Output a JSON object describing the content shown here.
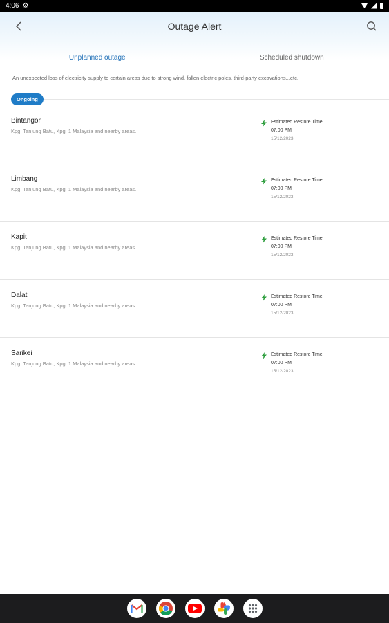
{
  "status_bar": {
    "time": "4:06"
  },
  "header": {
    "title": "Outage Alert"
  },
  "tabs": [
    {
      "label": "Unplanned outage",
      "active": true
    },
    {
      "label": "Scheduled shutdown",
      "active": false
    }
  ],
  "description": "An unexpected loss of electricity supply to certain areas due to strong wind, fallen electric poles, third-party excavations...etc.",
  "status_badge": "Ongoing",
  "outages": [
    {
      "name": "Bintangor",
      "areas": "Kpg. Tanjung Batu, Kpg. 1 Malaysia and nearby areas.",
      "restore_label": "Estimated Restore Time",
      "time": "07:00 PM",
      "date": "15/12/2023"
    },
    {
      "name": "Limbang",
      "areas": "Kpg. Tanjung Batu, Kpg. 1 Malaysia and nearby areas.",
      "restore_label": "Estimated Restore Time",
      "time": "07:00 PM",
      "date": "15/12/2023"
    },
    {
      "name": "Kapit",
      "areas": "Kpg. Tanjung Batu, Kpg. 1 Malaysia and nearby areas.",
      "restore_label": "Estimated Restore Time",
      "time": "07:00 PM",
      "date": "15/12/2023"
    },
    {
      "name": "Dalat",
      "areas": "Kpg. Tanjung Batu, Kpg. 1 Malaysia and nearby areas.",
      "restore_label": "Estimated Restore Time",
      "time": "07:00 PM",
      "date": "15/12/2023"
    },
    {
      "name": "Sarikei",
      "areas": "Kpg. Tanjung Batu, Kpg. 1 Malaysia and nearby areas.",
      "restore_label": "Estimated Restore Time",
      "time": "07:00 PM",
      "date": "15/12/2023"
    }
  ],
  "dock_apps": [
    "gmail-icon",
    "chrome-icon",
    "youtube-icon",
    "photos-icon",
    "app-drawer-icon"
  ],
  "colors": {
    "accent": "#1f6fb7",
    "badge": "#1f7cc7",
    "bolt": "#2e9e3e",
    "nav_bar": "#1c1c1e"
  }
}
